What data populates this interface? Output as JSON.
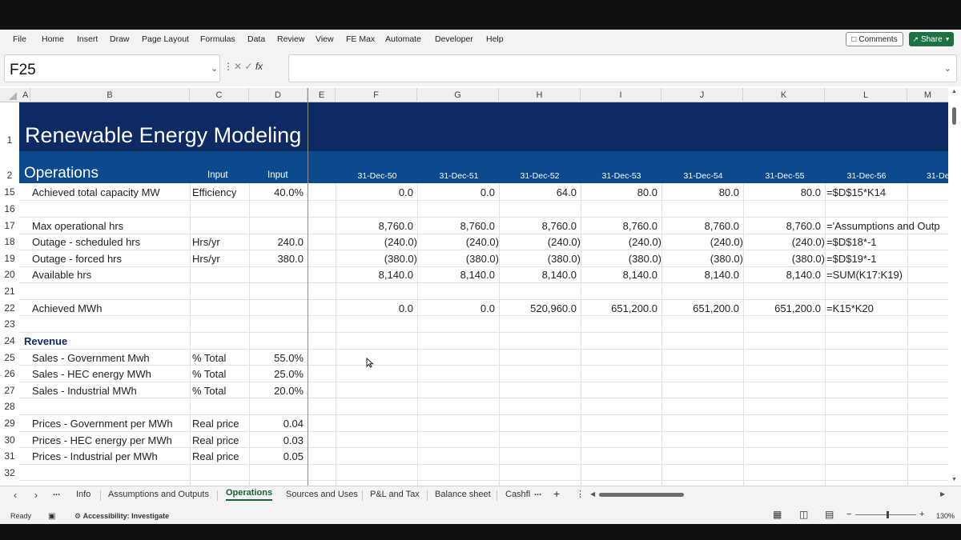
{
  "menu": {
    "items": [
      "File",
      "Home",
      "Insert",
      "Draw",
      "Page Layout",
      "Formulas",
      "Data",
      "Review",
      "View",
      "FE Max",
      "Automate",
      "Developer",
      "Help"
    ],
    "comments": "Comments",
    "share": "Share"
  },
  "formula_bar": {
    "name_box": "F25",
    "fx": "fx",
    "formula": ""
  },
  "columns": [
    "A",
    "B",
    "C",
    "D",
    "E",
    "F",
    "G",
    "H",
    "I",
    "J",
    "K",
    "L",
    "M"
  ],
  "header": {
    "title": "Renewable Energy Modeling",
    "section": "Operations",
    "input_label_c": "Input",
    "input_label_d": "Input",
    "dates": [
      "31-Dec-50",
      "31-Dec-51",
      "31-Dec-52",
      "31-Dec-53",
      "31-Dec-54",
      "31-Dec-55",
      "31-Dec-56",
      "31-De"
    ]
  },
  "rows": {
    "r15": {
      "num": "15",
      "label": "Achieved total capacity MW",
      "unit": "Efficiency",
      "input": "40.0%",
      "vals": [
        "0.0",
        "0.0",
        "64.0",
        "80.0",
        "80.0",
        "80.0"
      ],
      "formula": "=$D$15*K14"
    },
    "r16": {
      "num": "16"
    },
    "r17": {
      "num": "17",
      "label": "Max operational hrs",
      "vals": [
        "8,760.0",
        "8,760.0",
        "8,760.0",
        "8,760.0",
        "8,760.0",
        "8,760.0"
      ],
      "formula": "='Assumptions and Outp"
    },
    "r18": {
      "num": "18",
      "label": "Outage - scheduled hrs",
      "unit": "Hrs/yr",
      "input": "240.0",
      "vals": [
        "(240.0)",
        "(240.0)",
        "(240.0)",
        "(240.0)",
        "(240.0)",
        "(240.0)"
      ],
      "formula": "=$D$18*-1"
    },
    "r19": {
      "num": "19",
      "label": "Outage - forced hrs",
      "unit": "Hrs/yr",
      "input": "380.0",
      "vals": [
        "(380.0)",
        "(380.0)",
        "(380.0)",
        "(380.0)",
        "(380.0)",
        "(380.0)"
      ],
      "formula": "=$D$19*-1"
    },
    "r20": {
      "num": "20",
      "label": "Available hrs",
      "vals": [
        "8,140.0",
        "8,140.0",
        "8,140.0",
        "8,140.0",
        "8,140.0",
        "8,140.0"
      ],
      "formula": "=SUM(K17:K19)"
    },
    "r21": {
      "num": "21"
    },
    "r22": {
      "num": "22",
      "label": "Achieved MWh",
      "vals": [
        "0.0",
        "0.0",
        "520,960.0",
        "651,200.0",
        "651,200.0",
        "651,200.0"
      ],
      "formula": "=K15*K20"
    },
    "r23": {
      "num": "23"
    },
    "r24": {
      "num": "24",
      "label": "Revenue"
    },
    "r25": {
      "num": "25",
      "label": "Sales - Government Mwh",
      "unit": "% Total",
      "input": "55.0%"
    },
    "r26": {
      "num": "26",
      "label": "Sales - HEC energy MWh",
      "unit": "% Total",
      "input": "25.0%"
    },
    "r27": {
      "num": "27",
      "label": "Sales - Industrial MWh",
      "unit": "% Total",
      "input": "20.0%"
    },
    "r28": {
      "num": "28"
    },
    "r29": {
      "num": "29",
      "label": "Prices - Government per MWh",
      "unit": "Real price",
      "input": "0.04"
    },
    "r30": {
      "num": "30",
      "label": "Prices - HEC energy per MWh",
      "unit": "Real price",
      "input": "0.03"
    },
    "r31": {
      "num": "31",
      "label": "Prices - Industrial per MWh",
      "unit": "Real price",
      "input": "0.05"
    },
    "r32": {
      "num": "32"
    },
    "r1": {
      "num": "1"
    },
    "r2": {
      "num": "2"
    }
  },
  "tabs": {
    "ellipsis": "...",
    "items": [
      "Info",
      "Assumptions and Outputs",
      "Operations",
      "Sources and Uses",
      "P&L and Tax",
      "Balance sheet",
      "Cashfl"
    ],
    "active": "Operations",
    "more": "...",
    "add": "+"
  },
  "status": {
    "ready": "Ready",
    "accessibility": "Accessibility: Investigate",
    "zoom": "130%"
  }
}
